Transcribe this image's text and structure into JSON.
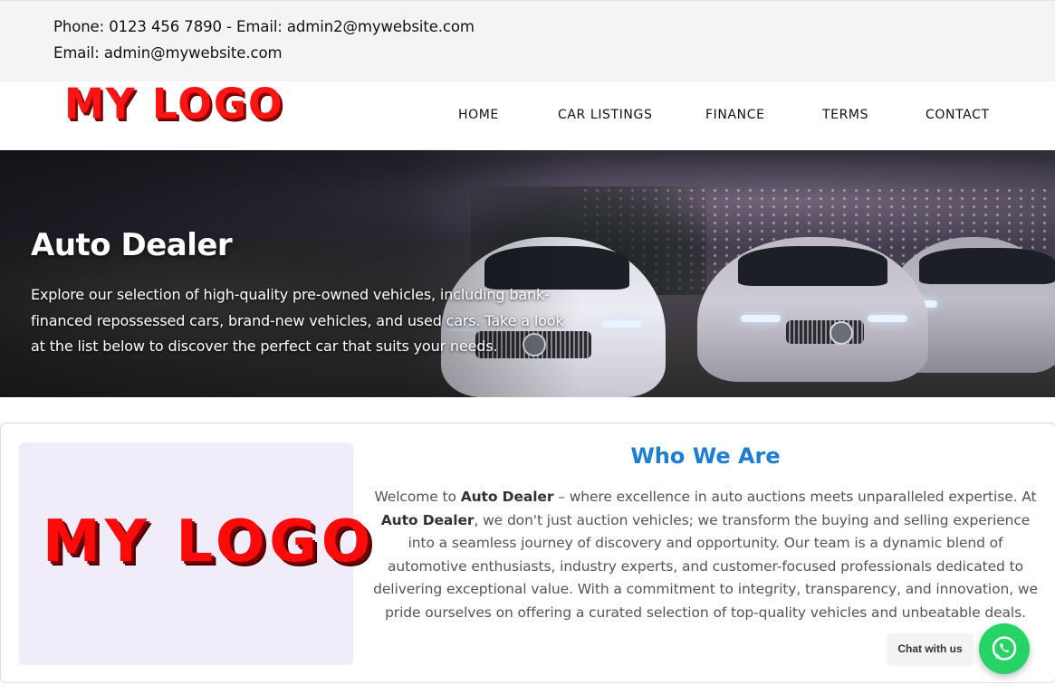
{
  "topbar": {
    "line1": "Phone: 0123 456 7890 - Email: admin2@mywebsite.com",
    "line2": "Email: admin@mywebsite.com"
  },
  "header": {
    "logo_text": "MY LOGO",
    "nav": [
      {
        "label": "HOME"
      },
      {
        "label": "CAR LISTINGS"
      },
      {
        "label": "FINANCE"
      },
      {
        "label": "TERMS"
      },
      {
        "label": "CONTACT"
      }
    ]
  },
  "hero": {
    "title": "Auto Dealer",
    "text": "Explore our selection of high-quality pre-owned vehicles, including bank-financed repossessed cars, brand-new vehicles, and used cars. Take a look at the list below to discover the perfect car that suits your needs."
  },
  "about": {
    "logo_text": "MY LOGO",
    "title": "Who We Are",
    "text_parts": {
      "p1": "Welcome to ",
      "brand1": "Auto Dealer",
      "p2": " – where excellence in auto auctions meets unparalleled expertise. At ",
      "brand2": "Auto Dealer",
      "p3": ", we don't just auction vehicles; we transform the buying and selling experience into a seamless journey of discovery and opportunity. Our team is a dynamic blend of automotive enthusiasts, industry experts, and customer-focused professionals dedicated to delivering exceptional value. With a commitment to integrity, transparency, and innovation, we pride ourselves on offering a curated selection of top-quality vehicles and unbeatable deals."
    }
  },
  "chat": {
    "label": "Chat with us",
    "icon": "whatsapp-icon"
  },
  "colors": {
    "accent_blue": "#1d7fd4",
    "logo_red": "#ff1414",
    "whatsapp_green": "#25d366",
    "topbar_bg": "#f4f4f4",
    "logo_box_bg": "#f0ecfa"
  }
}
